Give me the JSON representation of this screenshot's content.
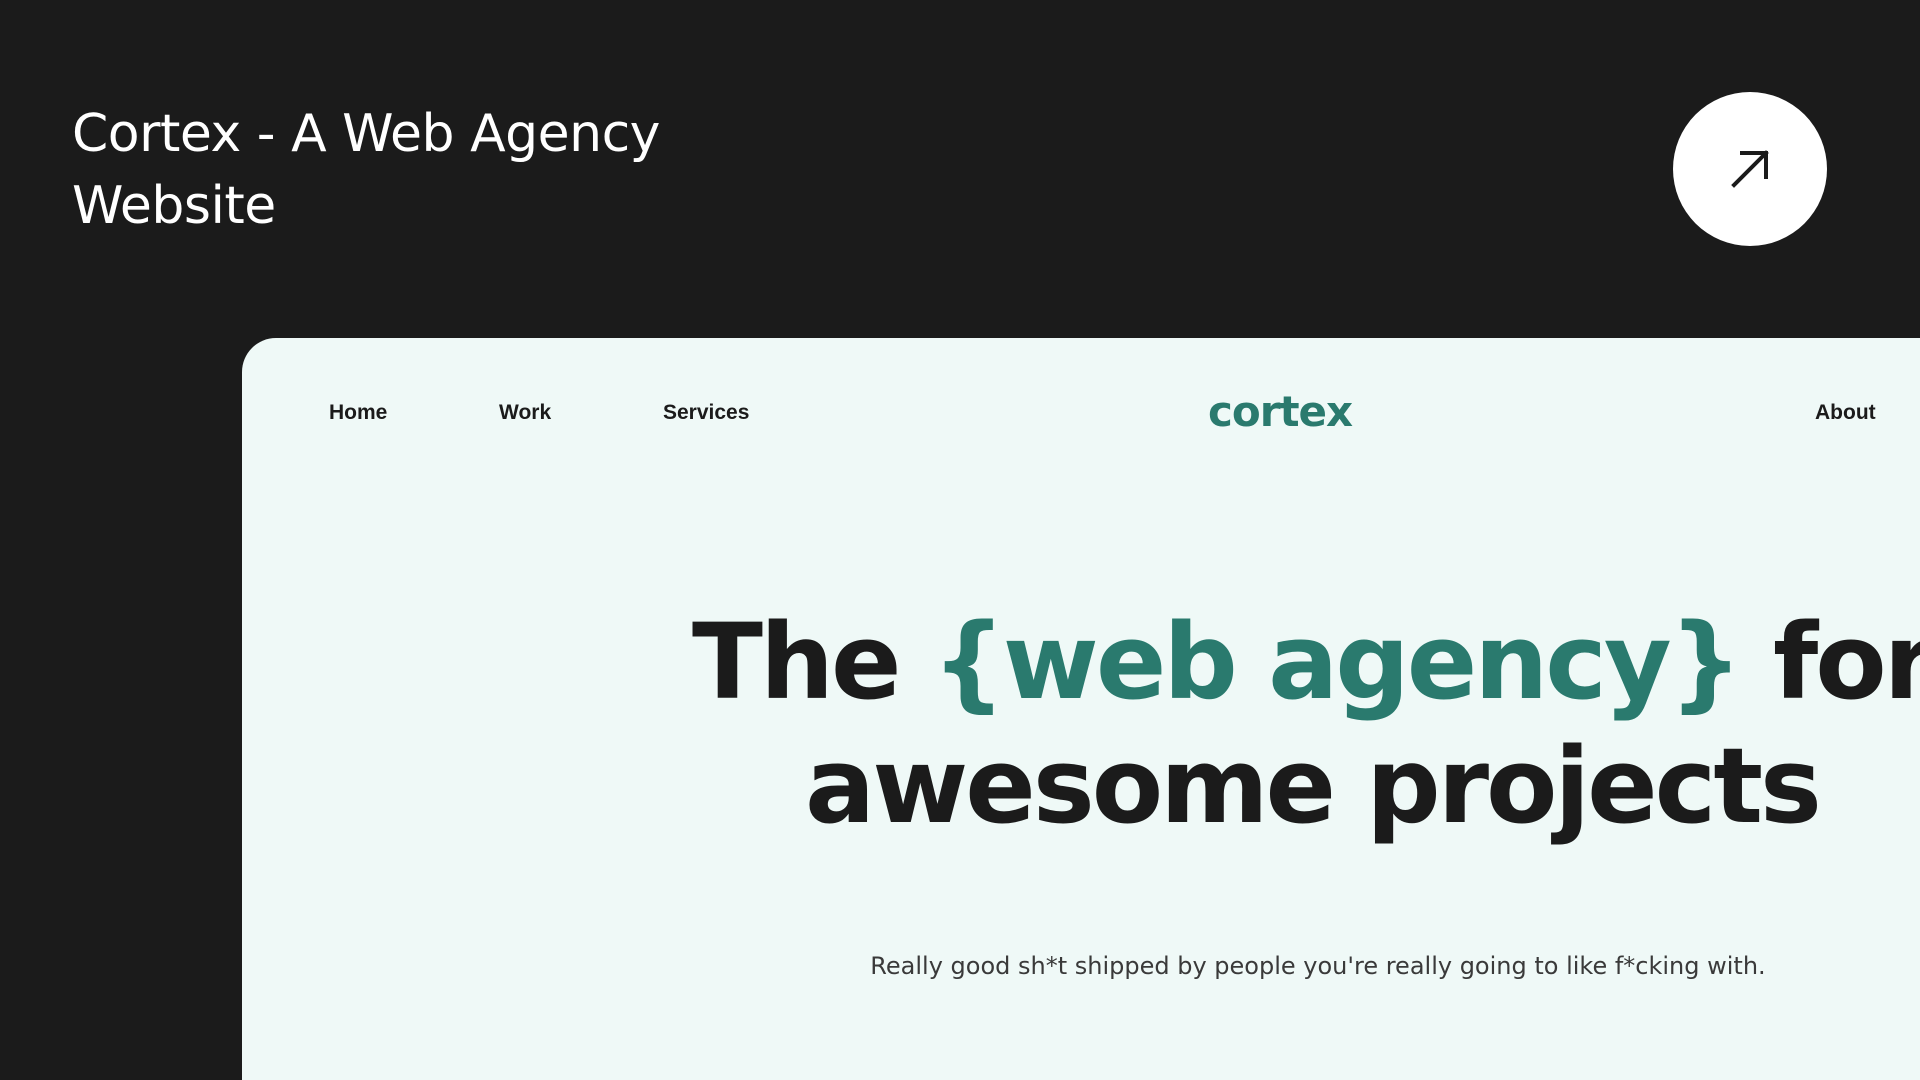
{
  "header": {
    "title": "Cortex - A Web Agency Website",
    "open_icon": "arrow-up-right-icon"
  },
  "preview": {
    "nav": {
      "home": "Home",
      "work": "Work",
      "services": "Services",
      "about": "About"
    },
    "logo": "cortex",
    "hero": {
      "headline_prefix": "The ",
      "headline_accent": "{web agency}",
      "headline_suffix_line1": " for",
      "headline_line2": "awesome projects",
      "subheadline": "Really good sh*t shipped by people you're really going to like f*cking with."
    }
  },
  "colors": {
    "background": "#1b1b1b",
    "preview_background": "#eff9f7",
    "accent": "#2a7a6e",
    "text_dark": "#1b1b1b",
    "text_light": "#ffffff"
  }
}
